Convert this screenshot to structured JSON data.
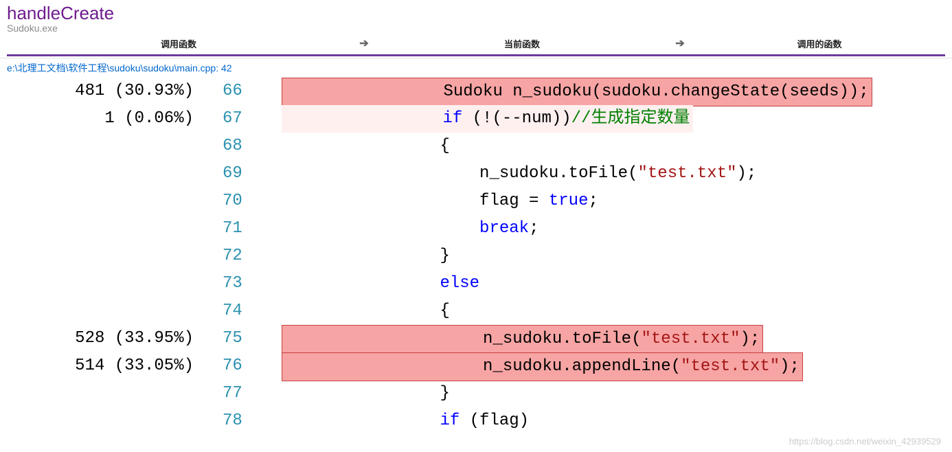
{
  "header": {
    "function_name": "handleCreate",
    "module": "Sudoku.exe",
    "columns": {
      "calling": "调用函数",
      "current": "当前函数",
      "called": "调用的函数"
    }
  },
  "filepath": "e:\\北理工文档\\软件工程\\sudoku\\sudoku\\main.cpp: 42",
  "lines": [
    {
      "metric": "481 (30.93%)",
      "num": "66",
      "highlight": "red",
      "tokens": [
        {
          "t": "                Sudoku n_sudoku(sudoku.changeState(seeds));"
        }
      ]
    },
    {
      "metric": "1 (0.06%)",
      "num": "67",
      "highlight": "light",
      "tokens": [
        {
          "t": "                "
        },
        {
          "t": "if",
          "c": "kw"
        },
        {
          "t": " (!(--num))"
        },
        {
          "t": "//生成指定数量",
          "c": "cmt"
        }
      ]
    },
    {
      "metric": "",
      "num": "68",
      "highlight": "",
      "tokens": [
        {
          "t": "                {"
        }
      ]
    },
    {
      "metric": "",
      "num": "69",
      "highlight": "",
      "tokens": [
        {
          "t": "                    n_sudoku.toFile("
        },
        {
          "t": "\"test.txt\"",
          "c": "str"
        },
        {
          "t": ");"
        }
      ]
    },
    {
      "metric": "",
      "num": "70",
      "highlight": "",
      "tokens": [
        {
          "t": "                    flag = "
        },
        {
          "t": "true",
          "c": "kw"
        },
        {
          "t": ";"
        }
      ]
    },
    {
      "metric": "",
      "num": "71",
      "highlight": "",
      "tokens": [
        {
          "t": "                    "
        },
        {
          "t": "break",
          "c": "kw"
        },
        {
          "t": ";"
        }
      ]
    },
    {
      "metric": "",
      "num": "72",
      "highlight": "",
      "tokens": [
        {
          "t": "                }"
        }
      ]
    },
    {
      "metric": "",
      "num": "73",
      "highlight": "",
      "tokens": [
        {
          "t": "                "
        },
        {
          "t": "else",
          "c": "kw"
        }
      ]
    },
    {
      "metric": "",
      "num": "74",
      "highlight": "",
      "tokens": [
        {
          "t": "                {"
        }
      ]
    },
    {
      "metric": "528 (33.95%)",
      "num": "75",
      "highlight": "red",
      "tokens": [
        {
          "t": "                    n_sudoku.toFile("
        },
        {
          "t": "\"test.txt\"",
          "c": "str"
        },
        {
          "t": ");"
        }
      ]
    },
    {
      "metric": "514 (33.05%)",
      "num": "76",
      "highlight": "red",
      "tokens": [
        {
          "t": "                    n_sudoku.appendLine("
        },
        {
          "t": "\"test.txt\"",
          "c": "str"
        },
        {
          "t": ");"
        }
      ]
    },
    {
      "metric": "",
      "num": "77",
      "highlight": "",
      "tokens": [
        {
          "t": "                }"
        }
      ]
    },
    {
      "metric": "",
      "num": "78",
      "highlight": "",
      "tokens": [
        {
          "t": "                "
        },
        {
          "t": "if",
          "c": "kw"
        },
        {
          "t": " (flag)"
        }
      ]
    }
  ],
  "watermark": "https://blog.csdn.net/weixin_42939529"
}
